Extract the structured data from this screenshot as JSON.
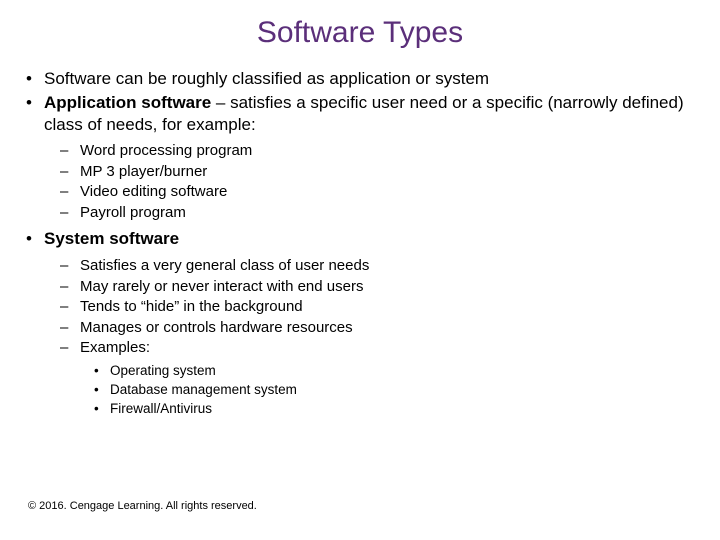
{
  "title": "Software Types",
  "bullets": {
    "b1": "Software can be roughly classified as application or system",
    "b2_prefix": "Application software",
    "b2_rest": " – satisfies a specific user need or a specific (narrowly defined) class of needs, for example:",
    "b3_prefix": "System software",
    "app": {
      "i1": "Word processing program",
      "i2": "MP 3 player/burner",
      "i3": "Video editing software",
      "i4": "Payroll program"
    },
    "sys": {
      "i1": "Satisfies a very general class of user needs",
      "i2": "May rarely or never interact with end users",
      "i3": "Tends to “hide” in the background",
      "i4": "Manages or controls hardware resources",
      "i5": "Examples:",
      "ex": {
        "e1": "Operating system",
        "e2": "Database management system",
        "e3": "Firewall/Antivirus"
      }
    }
  },
  "footer": "© 2016. Cengage Learning. All rights reserved."
}
